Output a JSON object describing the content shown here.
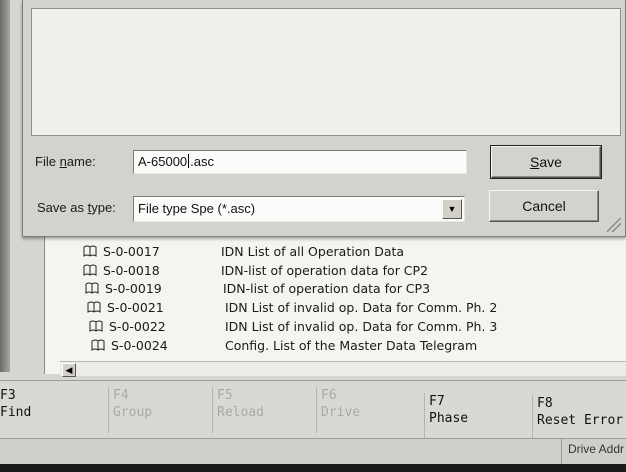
{
  "dialog": {
    "file_name_label_pre": "File ",
    "file_name_label_u": "n",
    "file_name_label_post": "ame:",
    "file_name_before_caret": "A-65000",
    "file_name_after_caret": ".asc",
    "save_as_type_label_pre": "Save as ",
    "save_as_type_label_u": "t",
    "save_as_type_label_post": "ype:",
    "save_as_type_value": "File type Spe (*.asc)",
    "save_button_u": "S",
    "save_button_rest": "ave",
    "cancel_button": "Cancel"
  },
  "list": {
    "rows": [
      {
        "idn": "S-0-0017",
        "desc": "IDN List of all Operation Data"
      },
      {
        "idn": "S-0-0018",
        "desc": "IDN-list of operation data for CP2"
      },
      {
        "idn": "S-0-0019",
        "desc": "IDN-list of operation data for CP3"
      },
      {
        "idn": "S-0-0021",
        "desc": "IDN List of invalid op. Data for Comm. Ph. 2"
      },
      {
        "idn": "S-0-0022",
        "desc": "IDN List of invalid op. Data for Comm. Ph. 3"
      },
      {
        "idn": "S-0-0024",
        "desc": "Config. List of the Master Data Telegram"
      }
    ]
  },
  "fkeys": [
    {
      "key": "F3",
      "label": "Find",
      "enabled": true
    },
    {
      "key": "F4",
      "label": "Group",
      "enabled": false
    },
    {
      "key": "F5",
      "label": "Reload",
      "enabled": false
    },
    {
      "key": "F6",
      "label": "Drive",
      "enabled": false
    },
    {
      "key": "F7",
      "label": "Phase",
      "enabled": true
    },
    {
      "key": "F8",
      "label": "Reset Error",
      "enabled": true
    }
  ],
  "statusbar": {
    "drive_addr": "Drive Addr"
  },
  "icons": {
    "list_item": "book-icon",
    "scroll_left": "arrow-left-icon",
    "combo_drop": "chevron-down-icon",
    "resize": "resize-grip-icon"
  }
}
